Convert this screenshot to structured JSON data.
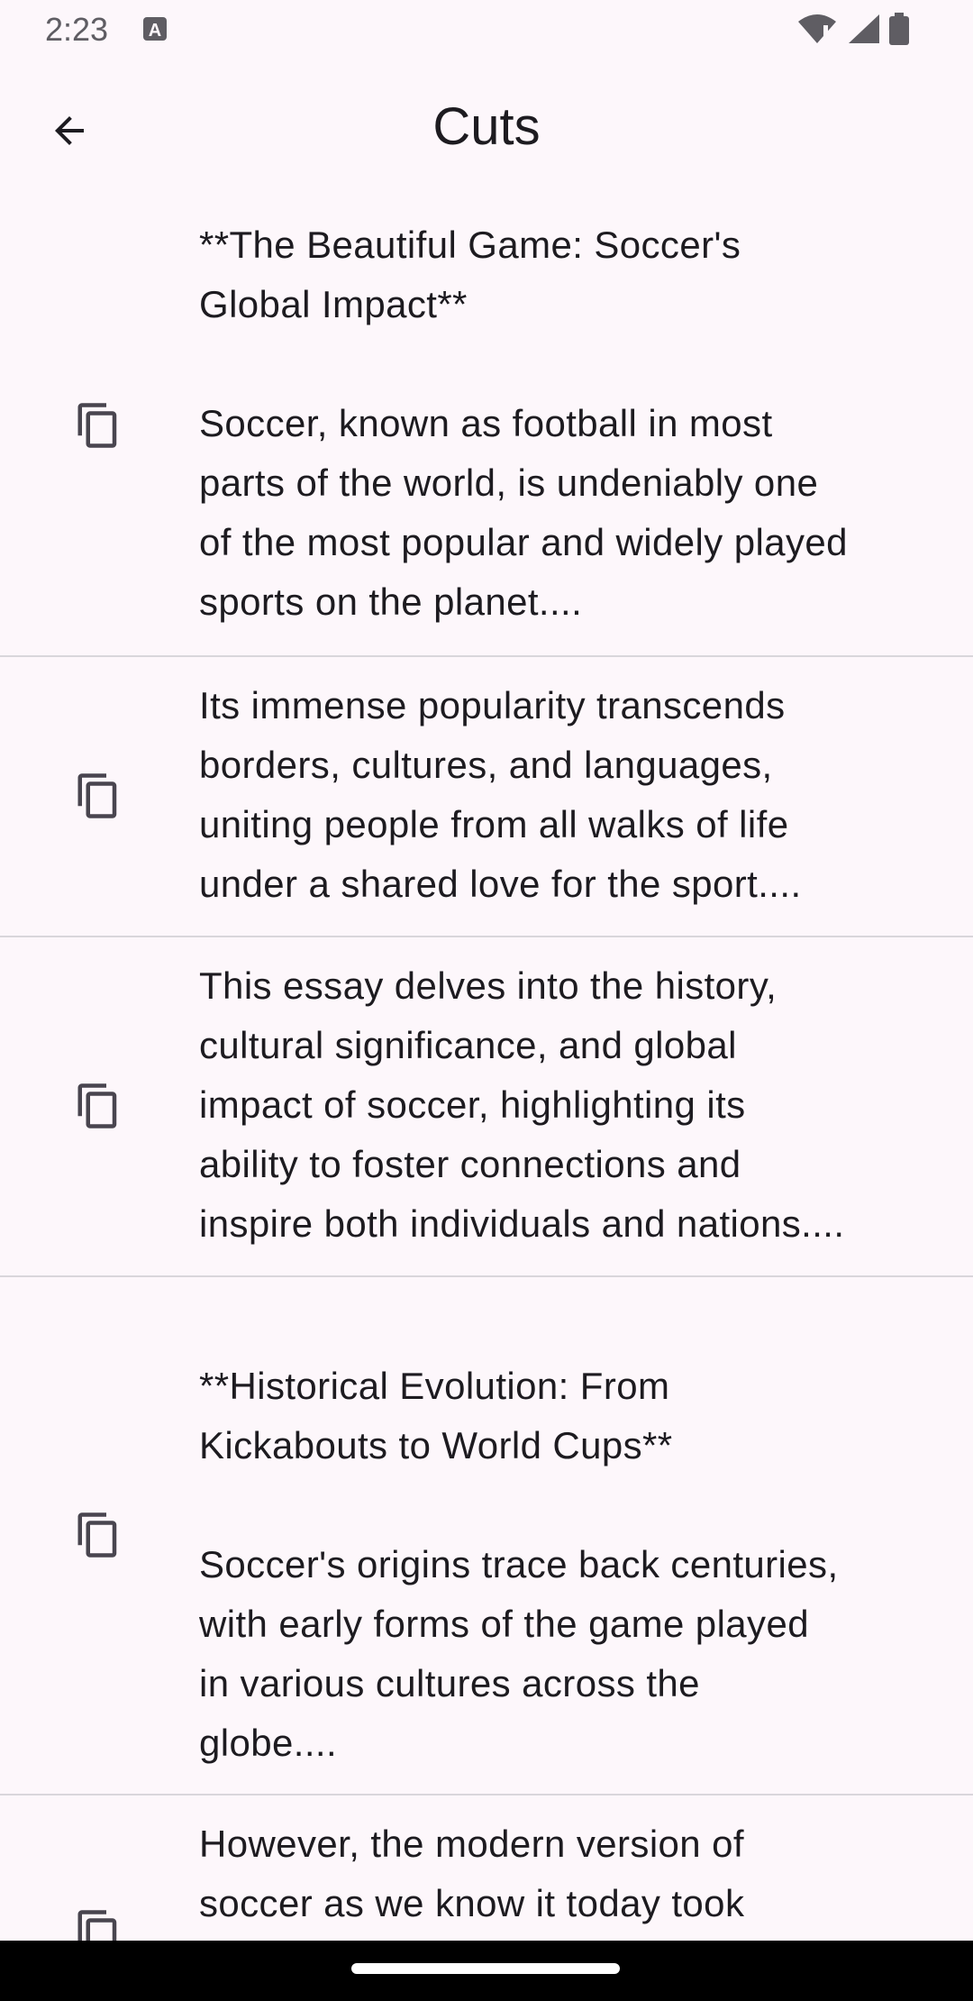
{
  "status_bar": {
    "time": "2:23",
    "icons": [
      "notification-a-icon",
      "wifi-icon",
      "signal-icon",
      "battery-icon"
    ]
  },
  "app_bar": {
    "title": "Cuts",
    "back_icon": "arrow-back-icon"
  },
  "cuts": [
    {
      "icon": "copy-icon",
      "text": "**The Beautiful Game: Soccer's\nGlobal Impact**\n\nSoccer, known as football in most\nparts of the world, is undeniably one\nof the most popular and widely played\nsports on the planet...."
    },
    {
      "icon": "copy-icon",
      "text": "Its immense popularity transcends\nborders, cultures, and languages,\nuniting people from all walks of life\nunder a shared love for the sport...."
    },
    {
      "icon": "copy-icon",
      "text": "This essay delves into the history,\ncultural significance, and global\nimpact of soccer, highlighting its\nability to foster connections and\ninspire both individuals and nations...."
    },
    {
      "icon": "copy-icon",
      "text": "\n**Historical Evolution: From\nKickabouts to World Cups**\n\nSoccer's origins trace back centuries,\nwith early forms of the game played\nin various cultures across the\nglobe...."
    },
    {
      "icon": "copy-icon",
      "text": "However, the modern version of\nsoccer as we know it today took"
    }
  ],
  "colors": {
    "background": "#fdf7fb",
    "text": "#1d1b20",
    "divider": "#d9d6db",
    "nav_bar": "#000000"
  }
}
